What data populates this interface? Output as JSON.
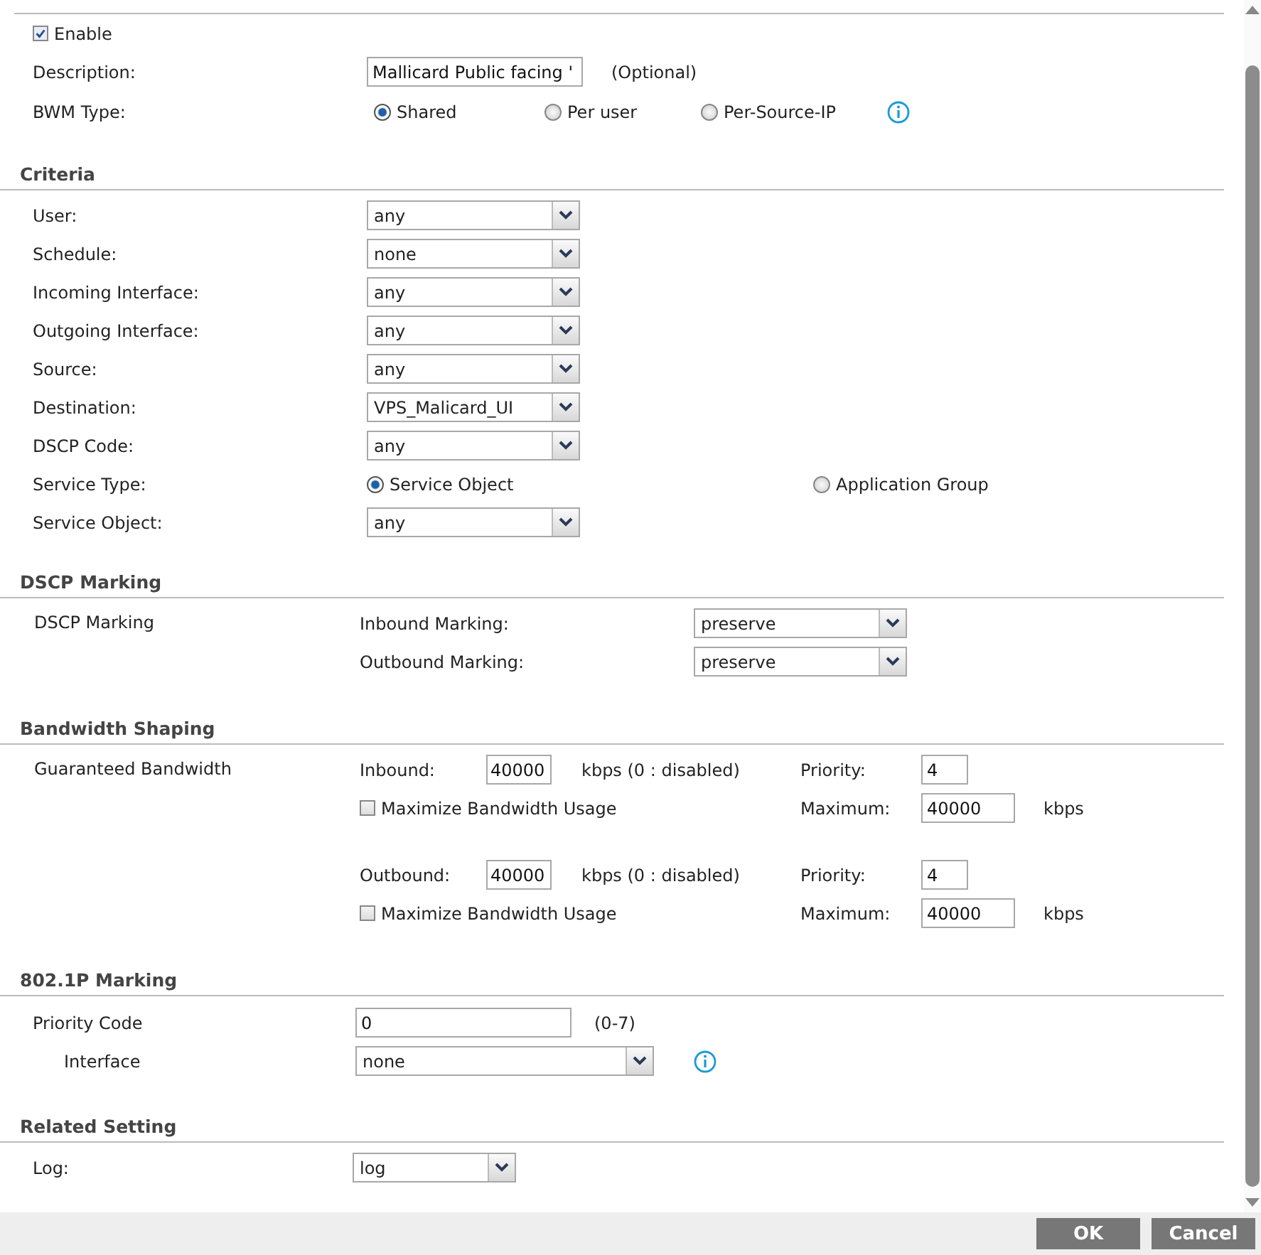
{
  "configuration": {
    "enable": {
      "label": "Enable",
      "checked": true
    },
    "description": {
      "label": "Description:",
      "value": "Mallicard Public facing '",
      "hint": "(Optional)"
    },
    "bwm_type": {
      "label": "BWM Type:",
      "options": [
        {
          "label": "Shared",
          "selected": true
        },
        {
          "label": "Per user",
          "selected": false
        },
        {
          "label": "Per-Source-IP",
          "selected": false
        }
      ]
    }
  },
  "criteria": {
    "title": "Criteria",
    "fields": [
      {
        "kind": "select",
        "label": "User:",
        "value": "any"
      },
      {
        "kind": "select",
        "label": "Schedule:",
        "value": "none"
      },
      {
        "kind": "select",
        "label": "Incoming Interface:",
        "value": "any"
      },
      {
        "kind": "select",
        "label": "Outgoing Interface:",
        "value": "any"
      },
      {
        "kind": "select",
        "label": "Source:",
        "value": "any"
      },
      {
        "kind": "select",
        "label": "Destination:",
        "value": "VPS_Malicard_UI"
      },
      {
        "kind": "select",
        "label": "DSCP Code:",
        "value": "any"
      },
      {
        "kind": "radio",
        "label": "Service Type:",
        "options": [
          {
            "label": "Service Object",
            "selected": true
          },
          {
            "label": "Application Group",
            "selected": false
          }
        ]
      },
      {
        "kind": "select",
        "label": "Service Object:",
        "value": "any"
      }
    ]
  },
  "dscp_marking": {
    "title": "DSCP Marking",
    "label": "DSCP Marking",
    "rows": [
      {
        "label": "Inbound Marking:",
        "value": "preserve"
      },
      {
        "label": "Outbound Marking:",
        "value": "preserve"
      }
    ]
  },
  "bandwidth_shaping": {
    "title": "Bandwidth Shaping",
    "label": "Guaranteed Bandwidth",
    "directions": [
      {
        "label": "Inbound:",
        "value": "40000",
        "unit": "kbps (0 : disabled)",
        "priority_label": "Priority:",
        "priority": "4",
        "maximize": {
          "label": "Maximize Bandwidth Usage",
          "checked": false
        },
        "maximum_label": "Maximum:",
        "maximum": "40000",
        "maximum_unit": "kbps"
      },
      {
        "label": "Outbound:",
        "value": "40000",
        "unit": "kbps (0 : disabled)",
        "priority_label": "Priority:",
        "priority": "4",
        "maximize": {
          "label": "Maximize Bandwidth Usage",
          "checked": false
        },
        "maximum_label": "Maximum:",
        "maximum": "40000",
        "maximum_unit": "kbps"
      }
    ]
  },
  "marking_8021p": {
    "title": "802.1P Marking",
    "priority_code": {
      "label": "Priority Code",
      "value": "0",
      "hint": "(0-7)"
    },
    "interface": {
      "label": "Interface",
      "value": "none"
    }
  },
  "related_setting": {
    "title": "Related Setting",
    "log": {
      "label": "Log:",
      "value": "log"
    }
  },
  "buttons": [
    {
      "label": "OK"
    },
    {
      "label": "Cancel"
    }
  ]
}
